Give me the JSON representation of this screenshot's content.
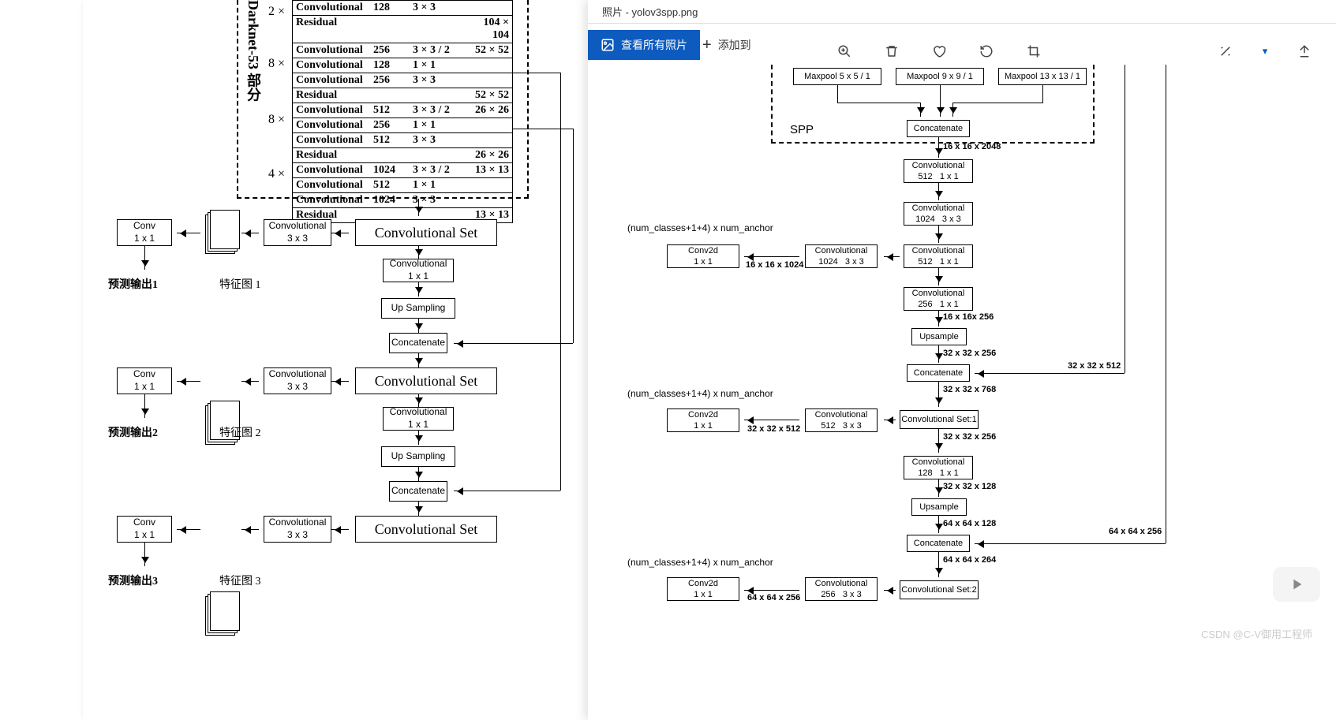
{
  "left": {
    "darknet_label": "Darknet-53 部分",
    "mults": [
      "2 ×",
      "8 ×",
      "8 ×",
      "4 ×"
    ],
    "rows": [
      [
        [
          "Convolutional",
          "128",
          "3 × 3",
          ""
        ],
        [
          "Residual",
          "",
          "",
          "104 × 104"
        ]
      ],
      [
        [
          "Convolutional",
          "256",
          "3 × 3 / 2",
          "52 × 52"
        ],
        [
          "Convolutional",
          "128",
          "1 × 1",
          ""
        ],
        [
          "Convolutional",
          "256",
          "3 × 3",
          ""
        ],
        [
          "Residual",
          "",
          "",
          "52 × 52"
        ]
      ],
      [
        [
          "Convolutional",
          "512",
          "3 × 3 / 2",
          "26 × 26"
        ],
        [
          "Convolutional",
          "256",
          "1 × 1",
          ""
        ],
        [
          "Convolutional",
          "512",
          "3 × 3",
          ""
        ],
        [
          "Residual",
          "",
          "",
          "26 × 26"
        ]
      ],
      [
        [
          "Convolutional",
          "1024",
          "3 × 3 / 2",
          "13 × 13"
        ],
        [
          "Convolutional",
          "512",
          "1 × 1",
          ""
        ],
        [
          "Convolutional",
          "1024",
          "3 × 3",
          ""
        ],
        [
          "Residual",
          "",
          "",
          "13 × 13"
        ]
      ]
    ],
    "convset": "Convolutional  Set",
    "conv3x3": {
      "l1": "Convolutional",
      "l2": "3 x 3"
    },
    "conv1x1": {
      "l1": "Conv",
      "l2": "1 x 1"
    },
    "conv1x1b": {
      "l1": "Convolutional",
      "l2": "1 x 1"
    },
    "upsample": "Up Sampling",
    "concat": "Concatenate",
    "featmap": {
      "1": "特征图 1",
      "2": "特征图 2",
      "3": "特征图 3"
    },
    "out": {
      "1": "预测输出1",
      "2": "预测输出2",
      "3": "预测输出3"
    }
  },
  "right": {
    "win_title": "照片 - yolov3spp.png",
    "btn_viewall": "查看所有照片",
    "btn_addto": "添加到",
    "spp_label": "SPP",
    "maxpool": {
      "5": "Maxpool  5 x 5 / 1",
      "9": "Maxpool  9 x 9 / 1",
      "13": "Maxpool  13 x 13 / 1"
    },
    "concat": "Concatenate",
    "upsample": "Upsample",
    "anchor_txt": "(num_classes+1+4) x num_anchor",
    "conv": {
      "512_1": "Convolutional\n512   1 x 1",
      "1024_3": "Convolutional\n1024   3 x 3",
      "512_1b": "Convolutional\n512   1 x 1",
      "256_1": "Convolutional\n256   1 x 1",
      "128_1": "Convolutional\n128   1 x 1",
      "1024_3b": "Convolutional\n1024   3 x 3",
      "512_3": "Convolutional\n512   3 x 3",
      "256_3": "Convolutional\n256   3 x 3"
    },
    "conv2d": "Conv2d\n1 x 1",
    "cset1": "Convolutional Set:1",
    "cset2": "Convolutional Set:2",
    "dims": {
      "16x2048": "16 x 16 x 2048",
      "16x1024": "16 x 16 x 1024",
      "16x256": "16 x 16x 256",
      "32x256": "32 x 32 x 256",
      "32x512_in": "32 x 32 x 512",
      "32x768": "32 x 32 x 768",
      "32x512": "32 x 32 x 512",
      "32x256b": "32 x 32 x 256",
      "32x128": "32 x 32 x 128",
      "64x128": "64 x 64 x 128",
      "64x256_in": "64 x 64 x 256",
      "64x264": "64 x 64 x 264",
      "64x256": "64 x 64 x 256"
    },
    "watermark": "CSDN @C-V御用工程师"
  }
}
